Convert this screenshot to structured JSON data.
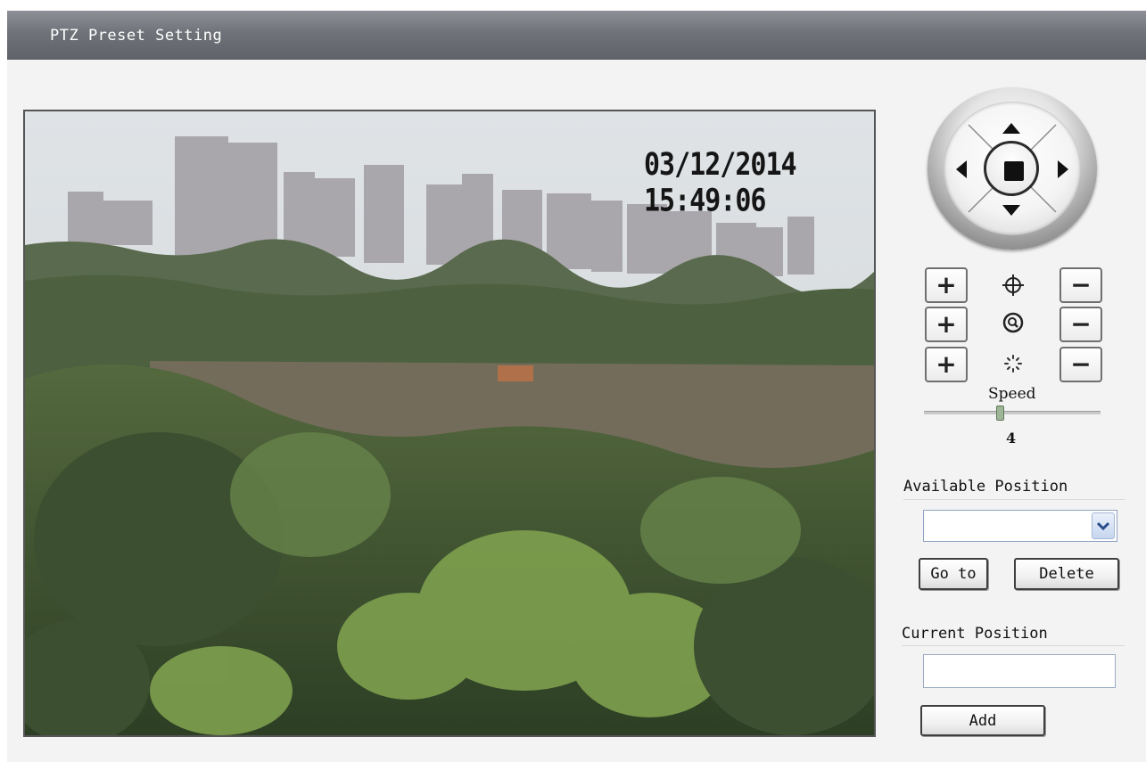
{
  "window": {
    "title": "PTZ Preset Setting"
  },
  "video": {
    "timestamp": "03/12/2014 15:49:06"
  },
  "ptz": {
    "rows": [
      {
        "name": "focus",
        "plus": "+",
        "minus": "−",
        "icon": "crosshair-icon"
      },
      {
        "name": "zoom",
        "plus": "+",
        "minus": "−",
        "icon": "magnifier-icon"
      },
      {
        "name": "iris",
        "plus": "+",
        "minus": "−",
        "icon": "iris-icon"
      }
    ],
    "speed_label": "Speed",
    "speed_value": "4",
    "speed_fraction": 0.43
  },
  "available_position": {
    "label": "Available Position",
    "selected": "",
    "goto_label": "Go to",
    "delete_label": "Delete"
  },
  "current_position": {
    "label": "Current Position",
    "value": "",
    "add_label": "Add"
  },
  "colors": {
    "titlebar": "#6f7278",
    "panel": "#f3f3f3",
    "select_border": "#8ea3c4"
  }
}
